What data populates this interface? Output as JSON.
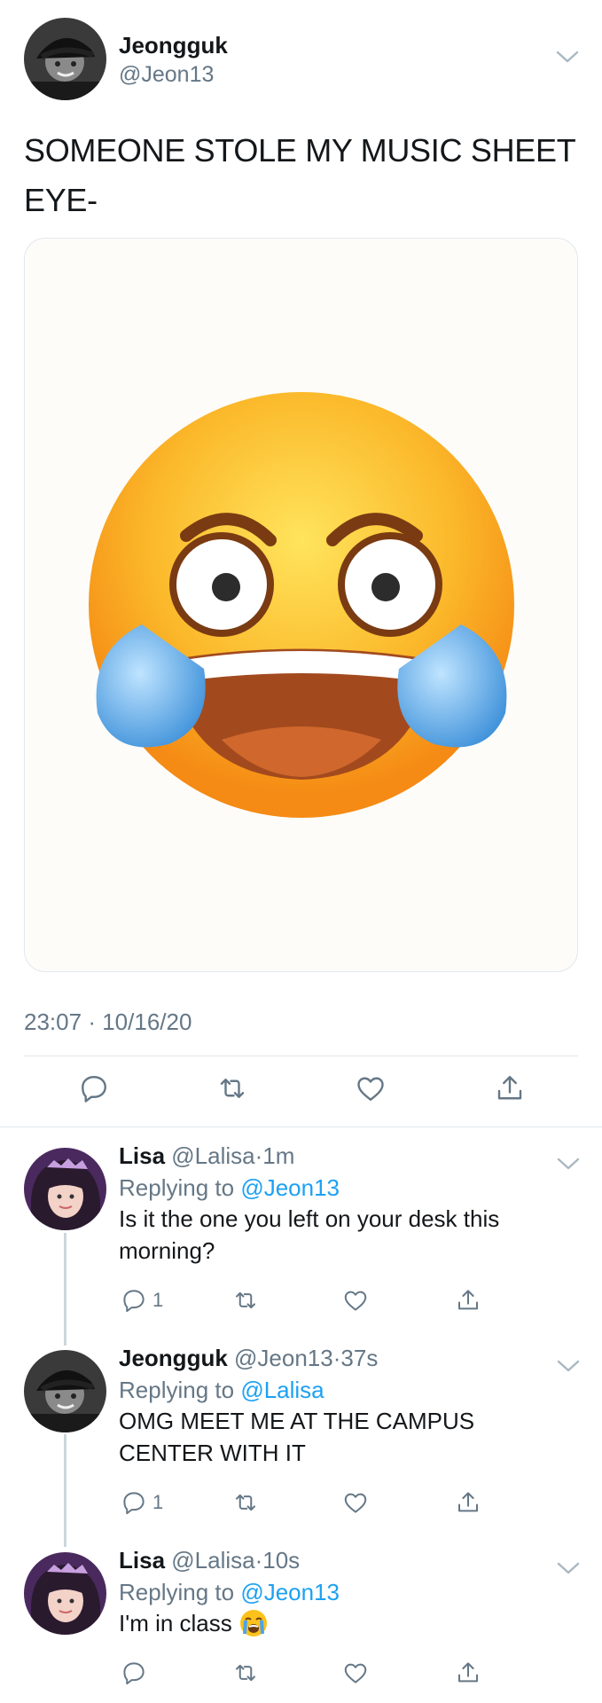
{
  "main_tweet": {
    "author_name": "Jeongguk",
    "author_handle": "@Jeon13",
    "text": "SOMEONE STOLE MY MUSIC SHEET EYE-",
    "time": "23:07",
    "date": "10/16/20",
    "separator": "·"
  },
  "replies": [
    {
      "name": "Lisa",
      "handle": "@Lalisa",
      "age": "1m",
      "replying_label": "Replying to",
      "replying_to": "@Jeon13",
      "text": "Is it the one you left on your desk this morning?",
      "reply_count": "1"
    },
    {
      "name": "Jeongguk",
      "handle": "@Jeon13",
      "age": "37s",
      "replying_label": "Replying to",
      "replying_to": "@Lalisa",
      "text": "OMG MEET ME AT THE CAMPUS CENTER WITH IT",
      "reply_count": "1"
    },
    {
      "name": "Lisa",
      "handle": "@Lalisa",
      "age": "10s",
      "replying_label": "Replying to",
      "replying_to": "@Jeon13",
      "text": "I'm in class",
      "reply_count": ""
    }
  ],
  "colors": {
    "link": "#1da1f2",
    "secondary_text": "#657786",
    "border": "#e1e8ed"
  },
  "icons": {
    "reply": "reply-icon",
    "retweet": "retweet-icon",
    "like": "heart-icon",
    "share": "share-icon",
    "chevron": "chevron-down-icon"
  }
}
